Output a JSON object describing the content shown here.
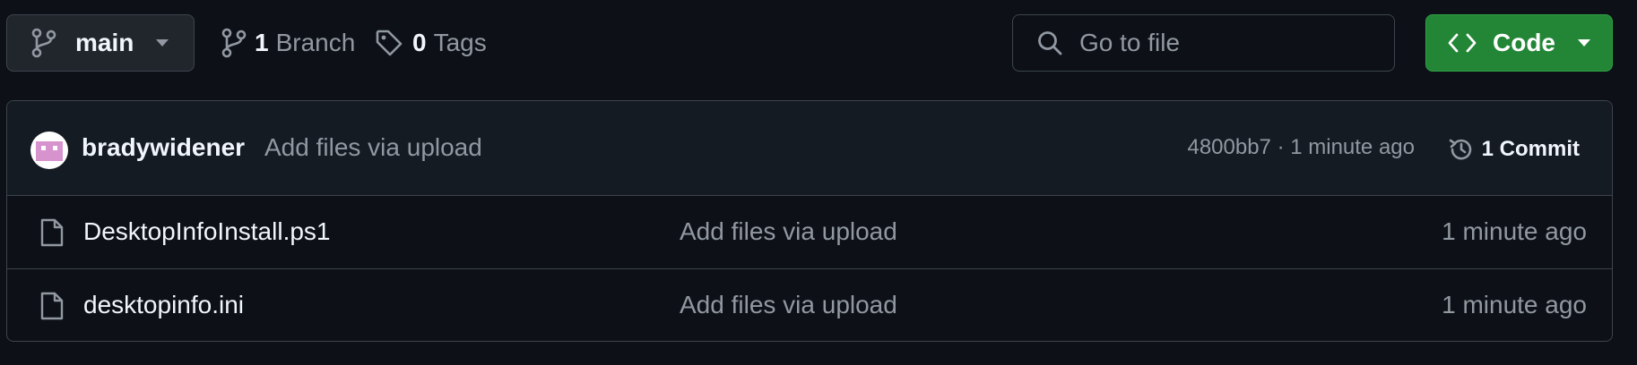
{
  "toolbar": {
    "branch": "main",
    "branches_count": "1",
    "branches_label": "Branch",
    "tags_count": "0",
    "tags_label": "Tags",
    "search_placeholder": "Go to file",
    "code_label": "Code"
  },
  "latest_commit": {
    "author": "bradywidener",
    "message": "Add files via upload",
    "meta": "4800bb7 · 1 minute ago",
    "commit_count_label": "1 Commit"
  },
  "files": [
    {
      "name": "DesktopInfoInstall.ps1",
      "message": "Add files via upload",
      "time": "1 minute ago"
    },
    {
      "name": "desktopinfo.ini",
      "message": "Add files via upload",
      "time": "1 minute ago"
    }
  ],
  "colors": {
    "background": "#0d1117",
    "code_button": "#238636",
    "avatar_pink": "#d793cd"
  },
  "icons": [
    "git-branch-icon",
    "chevron-down-icon",
    "tag-icon",
    "search-icon",
    "code-icon",
    "history-icon",
    "file-icon"
  ]
}
